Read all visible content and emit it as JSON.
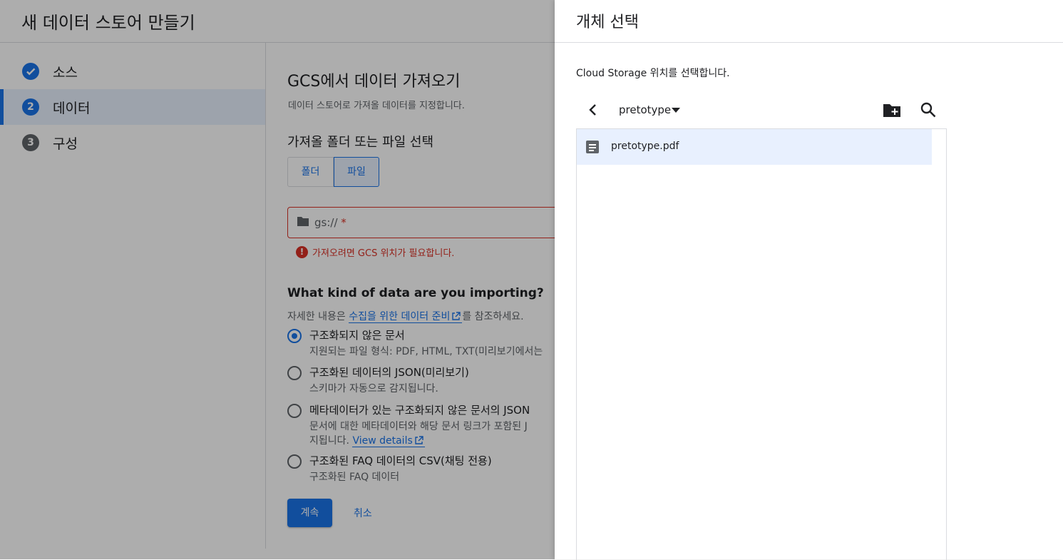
{
  "page": {
    "title": "새 데이터 스토어 만들기"
  },
  "stepper": {
    "steps": [
      {
        "number": "1",
        "label": "소스",
        "state": "done"
      },
      {
        "number": "2",
        "label": "데이터",
        "state": "current"
      },
      {
        "number": "3",
        "label": "구성",
        "state": "pending"
      }
    ]
  },
  "form": {
    "title": "GCS에서 데이터 가져오기",
    "subtitle": "데이터 스토어로 가져올 데이터를 지정합니다.",
    "picker_label": "가져올 폴더 또는 파일 선택",
    "toggle": {
      "folder": "폴더",
      "file": "파일",
      "selected": "파일"
    },
    "gcs_field": {
      "placeholder": "gs://",
      "required_mark": "*"
    },
    "error": "가져오려면 GCS 위치가 필요합니다.",
    "kind_title": "What kind of data are you importing?",
    "kind_desc_prefix": "자세한 내용은 ",
    "kind_desc_link": "수집을 위한 데이터 준비",
    "kind_desc_suffix": "를 참조하세요.",
    "options": [
      {
        "label": "구조화되지 않은 문서",
        "desc": "지원되는 파일 형식: PDF, HTML, TXT(미리보기에서는",
        "selected": true
      },
      {
        "label": "구조화된 데이터의 JSON(미리보기)",
        "desc": "스키마가 자동으로 감지됩니다.",
        "selected": false
      },
      {
        "label": "메타데이터가 있는 구조화되지 않은 문서의 JSON",
        "desc": "문서에 대한 메타데이터와 해당 문서 링크가 포함된 J",
        "desc2": "지됩니다.",
        "desc2_link": "View details",
        "selected": false
      },
      {
        "label": "구조화된 FAQ 데이터의 CSV(채팅 전용)",
        "desc": "구조화된 FAQ 데이터",
        "selected": false
      }
    ],
    "continue_label": "계속",
    "cancel_label": "취소"
  },
  "panel": {
    "title": "개체 선택",
    "description": "Cloud Storage 위치를 선택합니다.",
    "bucket": "pretotype",
    "files": [
      {
        "name": "pretotype.pdf",
        "icon": "document-icon",
        "selected": true
      }
    ]
  },
  "colors": {
    "accent": "#1a73e8",
    "error": "#d93025",
    "scrim": "rgba(0,0,0,0.32)"
  }
}
